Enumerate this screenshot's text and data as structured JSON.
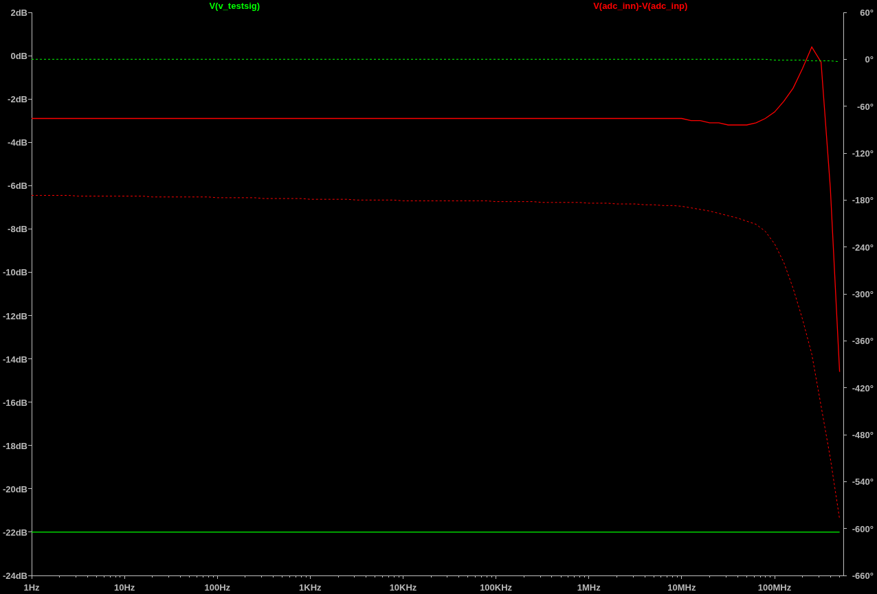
{
  "plot": {
    "chart_data": {
      "type": "line",
      "ylim": [
        -24,
        2
      ],
      "categories": [
        "1Hz",
        null,
        null,
        null,
        null,
        null,
        null,
        null,
        null,
        null,
        "10Hz",
        null,
        null,
        null,
        null,
        null,
        null,
        null,
        null,
        null,
        "100Hz",
        null,
        null,
        null,
        null,
        null,
        null,
        null,
        null,
        null,
        "1KHz",
        null,
        null,
        null,
        null,
        null,
        null,
        null,
        null,
        null,
        "10KHz",
        null,
        null,
        null,
        null,
        null,
        null,
        null,
        null,
        null,
        "100KHz",
        null,
        null,
        null,
        null,
        null,
        null,
        null,
        null,
        null,
        "1MHz",
        null,
        null,
        null,
        null,
        null,
        null,
        null,
        null,
        null,
        "10MHz",
        null,
        null,
        null,
        null,
        null,
        null,
        null,
        null,
        null,
        "100MHz",
        null,
        null,
        null,
        null,
        null,
        null,
        null
      ],
      "yticks": [
        {
          "value": 2,
          "label": "2dB"
        },
        {
          "value": 0,
          "label": "0dB"
        },
        {
          "value": -2,
          "label": "-2dB"
        },
        {
          "value": -4,
          "label": "-4dB"
        },
        {
          "value": -6,
          "label": "-6dB"
        },
        {
          "value": -8,
          "label": "-8dB"
        },
        {
          "value": -10,
          "label": "-10dB"
        },
        {
          "value": -12,
          "label": "-12dB"
        },
        {
          "value": -14,
          "label": "-14dB"
        },
        {
          "value": -16,
          "label": "-16dB"
        },
        {
          "value": -18,
          "label": "-18dB"
        },
        {
          "value": -20,
          "label": "-20dB"
        },
        {
          "value": -22,
          "label": "-22dB"
        },
        {
          "value": -24,
          "label": "-24dB"
        }
      ],
      "series": [
        {
          "name": "V(v_testsig)",
          "color": "#00ff00",
          "values": [
            -22,
            -22,
            -22,
            -22,
            -22,
            -22,
            -22,
            -22,
            -22,
            -22,
            -22,
            -22,
            -22,
            -22,
            -22,
            -22,
            -22,
            -22,
            -22,
            -22,
            -22,
            -22,
            -22,
            -22,
            -22,
            -22,
            -22,
            -22,
            -22,
            -22,
            -22,
            -22,
            -22,
            -22,
            -22,
            -22,
            -22,
            -22,
            -22,
            -22,
            -22,
            -22,
            -22,
            -22,
            -22,
            -22,
            -22,
            -22,
            -22,
            -22,
            -22,
            -22,
            -22,
            -22,
            -22,
            -22,
            -22,
            -22,
            -22,
            -22,
            -22,
            -22,
            -22,
            -22,
            -22,
            -22,
            -22,
            -22,
            -22,
            -22,
            -22,
            -22,
            -22,
            -22,
            -22,
            -22,
            -22,
            -22,
            -22,
            -22,
            -22,
            -22,
            -22,
            -22,
            -22,
            -22,
            -22,
            -22
          ]
        },
        {
          "name": "V(adc_inn)-V(adc_inp)",
          "color": "#ff0000",
          "values": [
            -2.9,
            -2.9,
            -2.9,
            -2.9,
            -2.9,
            -2.9,
            -2.9,
            -2.9,
            -2.9,
            -2.9,
            -2.9,
            -2.9,
            -2.9,
            -2.9,
            -2.9,
            -2.9,
            -2.9,
            -2.9,
            -2.9,
            -2.9,
            -2.9,
            -2.9,
            -2.9,
            -2.9,
            -2.9,
            -2.9,
            -2.9,
            -2.9,
            -2.9,
            -2.9,
            -2.9,
            -2.9,
            -2.9,
            -2.9,
            -2.9,
            -2.9,
            -2.9,
            -2.9,
            -2.9,
            -2.9,
            -2.9,
            -2.9,
            -2.9,
            -2.9,
            -2.9,
            -2.9,
            -2.9,
            -2.9,
            -2.9,
            -2.9,
            -2.9,
            -2.9,
            -2.9,
            -2.9,
            -2.9,
            -2.9,
            -2.9,
            -2.9,
            -2.9,
            -2.9,
            -2.9,
            -2.9,
            -2.9,
            -2.9,
            -2.9,
            -2.9,
            -2.9,
            -2.9,
            -2.9,
            -2.9,
            -2.9,
            -3.0,
            -3.0,
            -3.1,
            -3.1,
            -3.2,
            -3.2,
            -3.2,
            -3.1,
            -2.9,
            -2.6,
            -2.1,
            -1.5,
            -0.6,
            0.4,
            -0.3,
            -6.1,
            -14.6
          ]
        }
      ]
    }
  },
  "phase_plot": {
    "chart_data": {
      "type": "line",
      "ylim": [
        -660,
        60
      ],
      "yticks": [
        {
          "value": 60,
          "label": "60°"
        },
        {
          "value": 0,
          "label": "0°"
        },
        {
          "value": -60,
          "label": "-60°"
        },
        {
          "value": -120,
          "label": "-120°"
        },
        {
          "value": -180,
          "label": "-180°"
        },
        {
          "value": -240,
          "label": "-240°"
        },
        {
          "value": -300,
          "label": "-300°"
        },
        {
          "value": -360,
          "label": "-360°"
        },
        {
          "value": -420,
          "label": "-420°"
        },
        {
          "value": -480,
          "label": "-480°"
        },
        {
          "value": -540,
          "label": "-540°"
        },
        {
          "value": -600,
          "label": "-600°"
        },
        {
          "value": -660,
          "label": "-660°"
        }
      ],
      "series": [
        {
          "color": "#00ff00",
          "line_style": "dashed",
          "values": [
            0,
            0,
            0,
            0,
            0,
            0,
            0,
            0,
            0,
            0,
            0,
            0,
            0,
            0,
            0,
            0,
            0,
            0,
            0,
            0,
            0,
            0,
            0,
            0,
            0,
            0,
            0,
            0,
            0,
            0,
            0,
            0,
            0,
            0,
            0,
            0,
            0,
            0,
            0,
            0,
            0,
            0,
            0,
            0,
            0,
            0,
            0,
            0,
            0,
            0,
            0,
            0,
            0,
            0,
            0,
            0,
            0,
            0,
            0,
            0,
            0,
            0,
            0,
            0,
            0,
            0,
            0,
            0,
            0,
            0,
            0,
            0,
            0,
            0,
            0,
            0,
            0,
            0,
            0,
            0,
            -1,
            -1,
            -1,
            -1,
            -2,
            -2,
            -2,
            -3
          ]
        },
        {
          "color": "#ff0000",
          "line_style": "dashed",
          "values": [
            -174,
            -174,
            -174,
            -174,
            -174,
            -175,
            -175,
            -175,
            -175,
            -175,
            -175,
            -175,
            -175,
            -176,
            -176,
            -176,
            -176,
            -176,
            -176,
            -176,
            -177,
            -177,
            -177,
            -177,
            -177,
            -178,
            -178,
            -178,
            -178,
            -178,
            -179,
            -179,
            -179,
            -179,
            -179,
            -180,
            -180,
            -180,
            -180,
            -180,
            -181,
            -181,
            -181,
            -181,
            -181,
            -181,
            -181,
            -181,
            -181,
            -181,
            -182,
            -182,
            -182,
            -182,
            -182,
            -183,
            -183,
            -183,
            -183,
            -183,
            -184,
            -184,
            -184,
            -185,
            -185,
            -185,
            -186,
            -186,
            -187,
            -187,
            -188,
            -190,
            -192,
            -194,
            -197,
            -200,
            -203,
            -207,
            -211,
            -220,
            -236,
            -260,
            -293,
            -332,
            -377,
            -443,
            -510,
            -588
          ]
        }
      ]
    }
  }
}
